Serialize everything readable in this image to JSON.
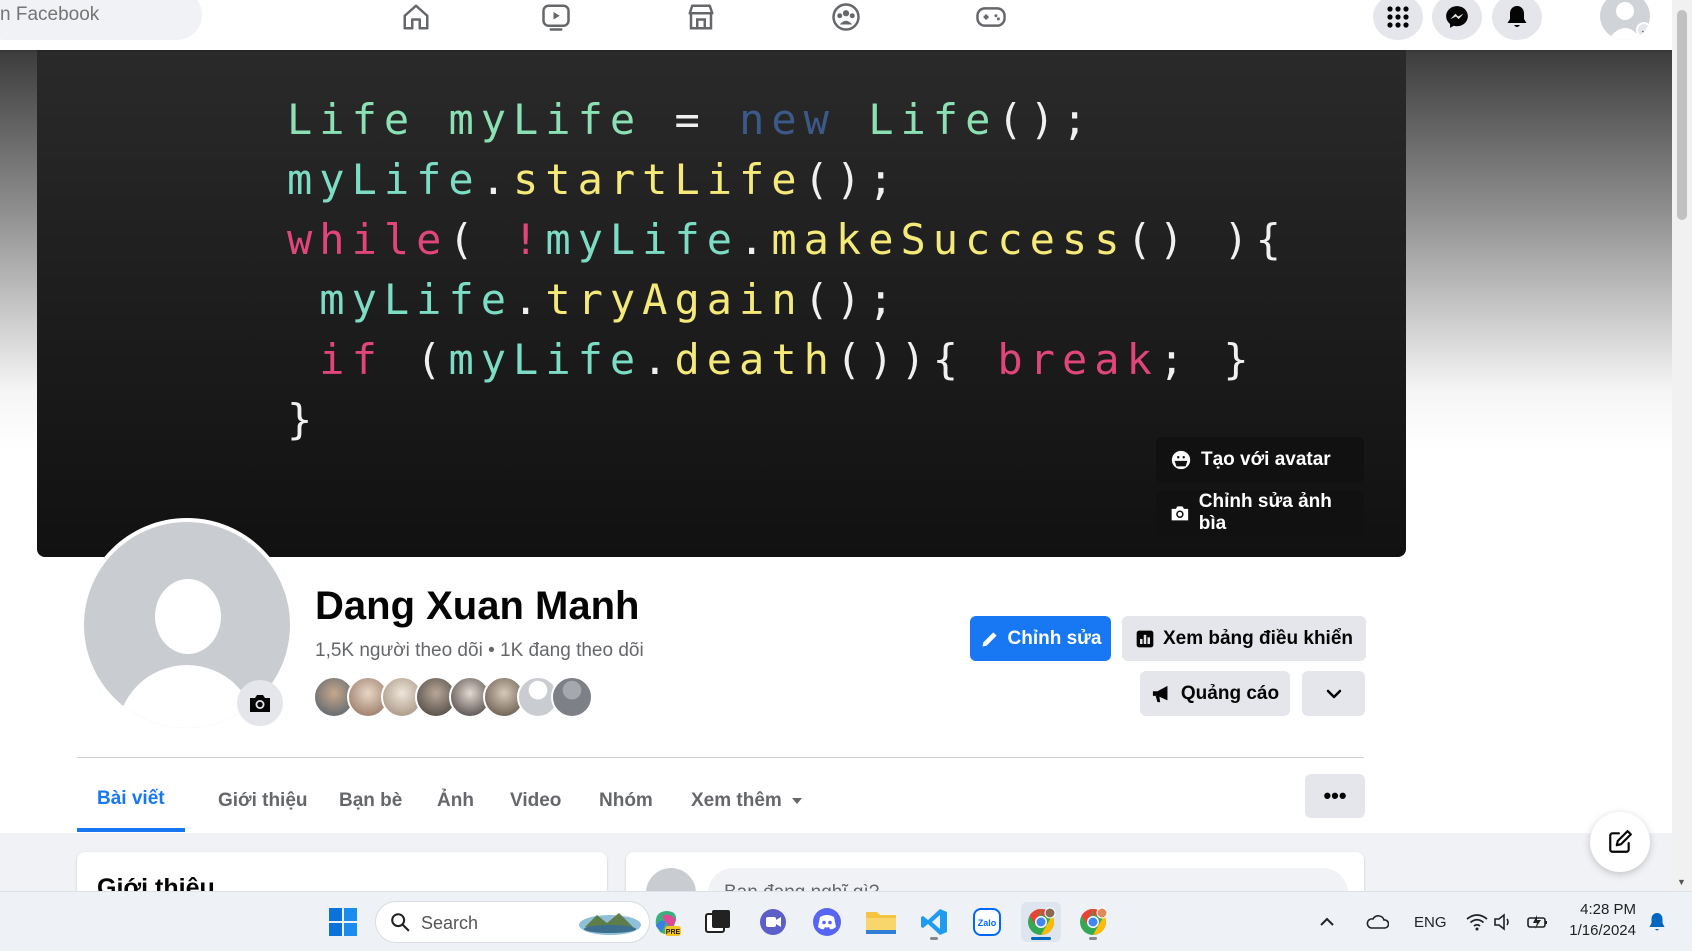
{
  "search": {
    "placeholder": "n Facebook"
  },
  "cover": {
    "buttons": {
      "create_avatar": "Tạo với avatar",
      "edit_cover": "Chỉnh sửa ảnh bìa"
    }
  },
  "profile": {
    "name": "Dang Xuan Manh",
    "stats": "1,5K người theo dõi • 1K đang theo dõi"
  },
  "actions": {
    "edit": "Chỉnh sửa",
    "dashboard": "Xem bảng điều khiển",
    "ads": "Quảng cáo"
  },
  "tabs": [
    "Bài viết",
    "Giới thiệu",
    "Bạn bè",
    "Ảnh",
    "Video",
    "Nhóm",
    "Xem thêm"
  ],
  "more_label": "•••",
  "intro_card": {
    "title": "Giới thiệu"
  },
  "composer": {
    "placeholder": "Bạn đang nghĩ gì?"
  },
  "taskbar": {
    "search_label": "Search",
    "language": "ENG",
    "time": "4:28 PM",
    "date": "1/16/2024"
  },
  "colors": {
    "brand": "#1877f2",
    "nav_text": "#65676b"
  }
}
